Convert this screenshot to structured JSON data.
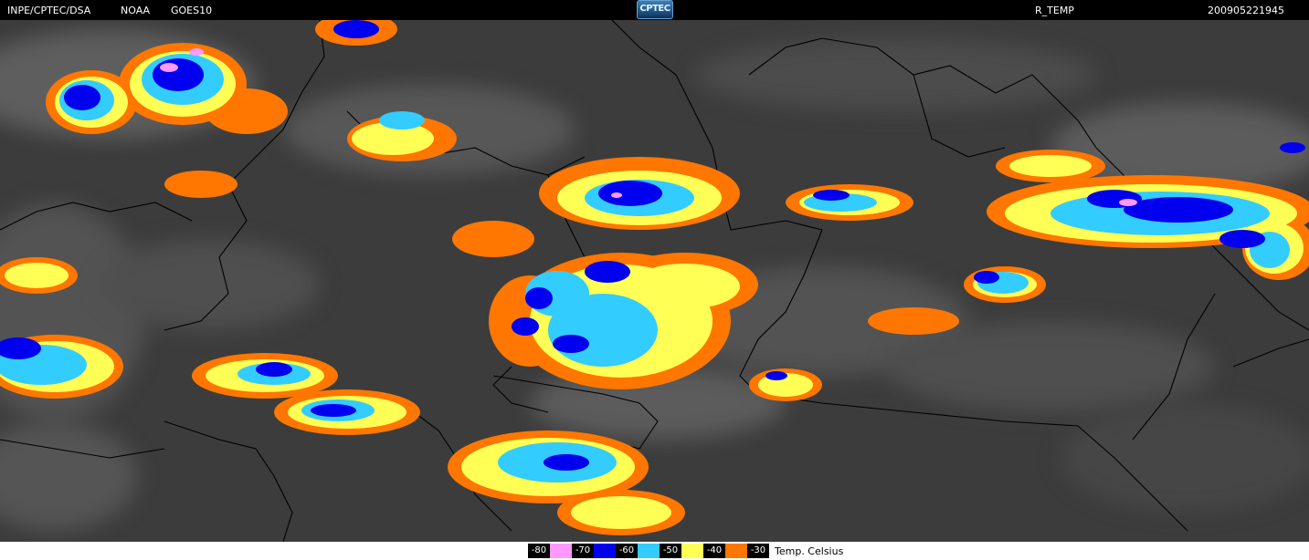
{
  "header": {
    "source": "INPE/CPTEC/DSA",
    "agency": "NOAA",
    "satellite": "GOES10",
    "logo_text": "CPTEC",
    "product": "R_TEMP",
    "timestamp": "200905221945"
  },
  "legend": {
    "items": [
      {
        "label": "-80",
        "color": "#ff99ff"
      },
      {
        "label": "-70",
        "color": "#0000ee"
      },
      {
        "label": "-60",
        "color": "#33ccff"
      },
      {
        "label": "-50",
        "color": "#ffff55"
      },
      {
        "label": "-40",
        "color": "#ff7700"
      },
      {
        "label": "-30",
        "color": "#000000"
      }
    ],
    "unit": "Temp. Celsius"
  }
}
